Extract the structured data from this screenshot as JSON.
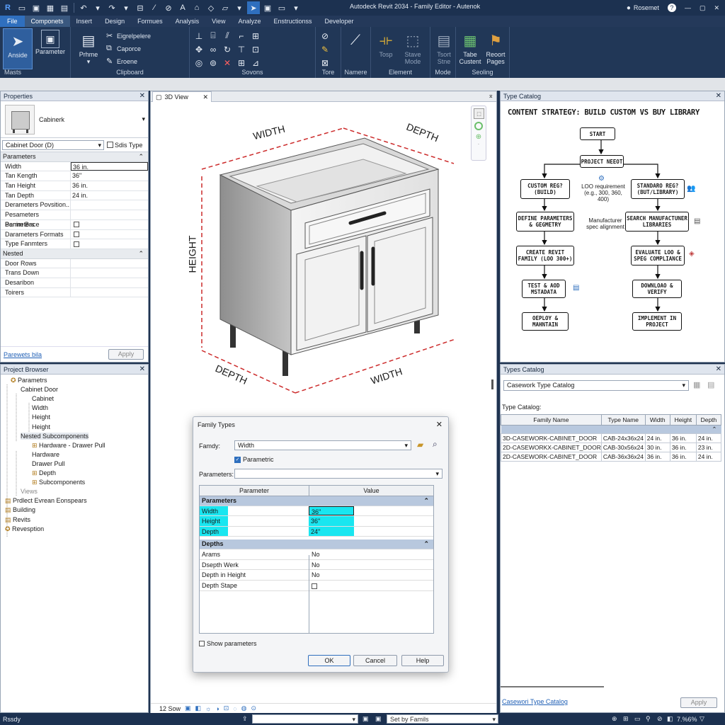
{
  "titlebar": {
    "title": "Autodeck Revit 2034 - Family Editor - Autenok",
    "user": "Rosemet"
  },
  "menu": {
    "tabs": [
      "File",
      "Componets",
      "Insert",
      "Design",
      "Formues",
      "Analysis",
      "View",
      "Analyze",
      "Enstructionss",
      "Developer"
    ]
  },
  "ribbon": {
    "modify": {
      "label": "Anside",
      "group": "Masts"
    },
    "parameter": {
      "label": "Parameter"
    },
    "clipboard": {
      "big": "Prhme",
      "items": [
        "Eigrelpelere",
        "Caporce",
        "Eroene"
      ],
      "group": "Clipboard"
    },
    "sovons": {
      "group": "Sovons"
    },
    "tore": {
      "group": "Tore"
    },
    "namere": {
      "group": "Namere"
    },
    "element": {
      "items": [
        "Tosp",
        "Stave Mode"
      ],
      "group": "Element"
    },
    "mode": {
      "items": [
        "Tsort Stne"
      ],
      "group": "Mode"
    },
    "seoling": {
      "items": [
        "Tabe Custent",
        "Reoort Pages"
      ],
      "group": "Seoling"
    }
  },
  "properties": {
    "title": "Properties",
    "family": "Cabinerk",
    "type_selector": "Cabinet Door (D)",
    "edit_type": "Sdis Type",
    "group1": "Parameters",
    "rows": [
      {
        "k": "Width",
        "v": "36 in."
      },
      {
        "k": "Tan Kength",
        "v": "36\""
      },
      {
        "k": "Tan Height",
        "v": "36 in."
      },
      {
        "k": "Tan Depth",
        "v": "24 in."
      },
      {
        "k": "Derameters Povsition..",
        "v": ""
      },
      {
        "k": "Pesameters Parmeters",
        "v": ""
      },
      {
        "k": "Benim Bace",
        "v": ""
      },
      {
        "k": "Darameters Formats",
        "v": ""
      },
      {
        "k": "Type Fanmters",
        "v": ""
      }
    ],
    "group2": "Nested",
    "rows2": [
      "Door Rows",
      "Trans Down",
      "Desaribon",
      "Toirers"
    ],
    "help_link": "Parewets bila",
    "apply": "Apply"
  },
  "browser": {
    "title": "Project Browser",
    "items": [
      "Parametrs",
      "Cabinet Door",
      "Cabinet",
      "Width",
      "Height",
      "Height",
      "Nested Subcomponents",
      "Hardware - Drawer Pull",
      "Hardware",
      "Drawer Pull",
      "Depth",
      "Subcomponents",
      "Views",
      "Prdlect Evrean Eonspears",
      "Building",
      "Revits",
      "Revesption"
    ]
  },
  "view": {
    "tab": "3D View",
    "labels": {
      "width_top": "WIDTH",
      "depth_top": "DEPTH",
      "height": "HEIGHT",
      "depth_bottom": "DEPTH",
      "width_bottom": "WIDTH"
    },
    "scale": "12 Sow"
  },
  "dialog": {
    "title": "Family Types",
    "family_label": "Famdy:",
    "family_value": "Width",
    "parametric": "Parametric",
    "parameters_label": "Parameters:",
    "col1": "Parameter",
    "col2": "Value",
    "group1": "Parameters",
    "rows1": [
      {
        "k": "Width",
        "v": "36\""
      },
      {
        "k": "Height",
        "v": "36\""
      },
      {
        "k": "Depth",
        "v": "24\""
      }
    ],
    "group2": "Depths",
    "rows2": [
      {
        "k": "Arams",
        "v": "No"
      },
      {
        "k": "Dsepth Werk",
        "v": "No"
      },
      {
        "k": "Depth in Height",
        "v": "No"
      },
      {
        "k": "Depth Stape",
        "v": ""
      }
    ],
    "show_params": "Show parameters",
    "ok": "OK",
    "cancel": "Cancel",
    "help": "Help"
  },
  "catalog_top": {
    "title": "Type Catalog",
    "heading": "CONTENT STRATEGY: BUILD CUSTOM VS BUY LIBRARY",
    "nodes": {
      "start": "START",
      "need": "PROJECT NEEOT",
      "custom": "CUSTOM REG? (BUILD)",
      "standard": "STANDARO REG? (BUT/LIBRARY)",
      "lod": "LOO requirement (e.g., 300, 360, 400)",
      "define": "DEFINE PARAMETERS & GEGMETRY",
      "search": "SEARCH MANUFACTUNER LIBRARIES",
      "manuf": "Manufacturer spec alignment",
      "create": "CREATE REVIT FAMILY (LOO 300+)",
      "evaluate": "EVALUATE LOO & SPEG COMPLIANCE",
      "test": "TEST & AOD MSTADATA",
      "download": "DOWNLOAO & VERIFY",
      "deploy": "OEPLOY & MAHNTAIN",
      "implement": "IMPLEMENT IN PROJECT"
    }
  },
  "catalog_bottom": {
    "title": "Types Catalog",
    "select": "Casework Type Catalog",
    "label": "Type Catalog:",
    "headers": [
      "Family Name",
      "Type Name",
      "Width",
      "Height",
      "Depth"
    ],
    "rows": [
      [
        "3D-CASEWORK-CABINET_DOOR",
        "CAB-24x36x24",
        "24 in.",
        "36 in.",
        "24 in."
      ],
      [
        "2D-CASEWORKX-CABINET_DOOR",
        "CAB-30x56x24",
        "30 in.",
        "36 in.",
        "23 in."
      ],
      [
        "2D-CASEWORK-CABINET_DOOR",
        "CAB-36x36x24",
        "36 in.",
        "36 in.",
        "24 in."
      ]
    ],
    "link": "Casewori Type Catalog",
    "apply": "Apply"
  },
  "status": {
    "left": "Rssdy",
    "dropdown": "Set by Famils",
    "zoom": "7.%6%"
  }
}
